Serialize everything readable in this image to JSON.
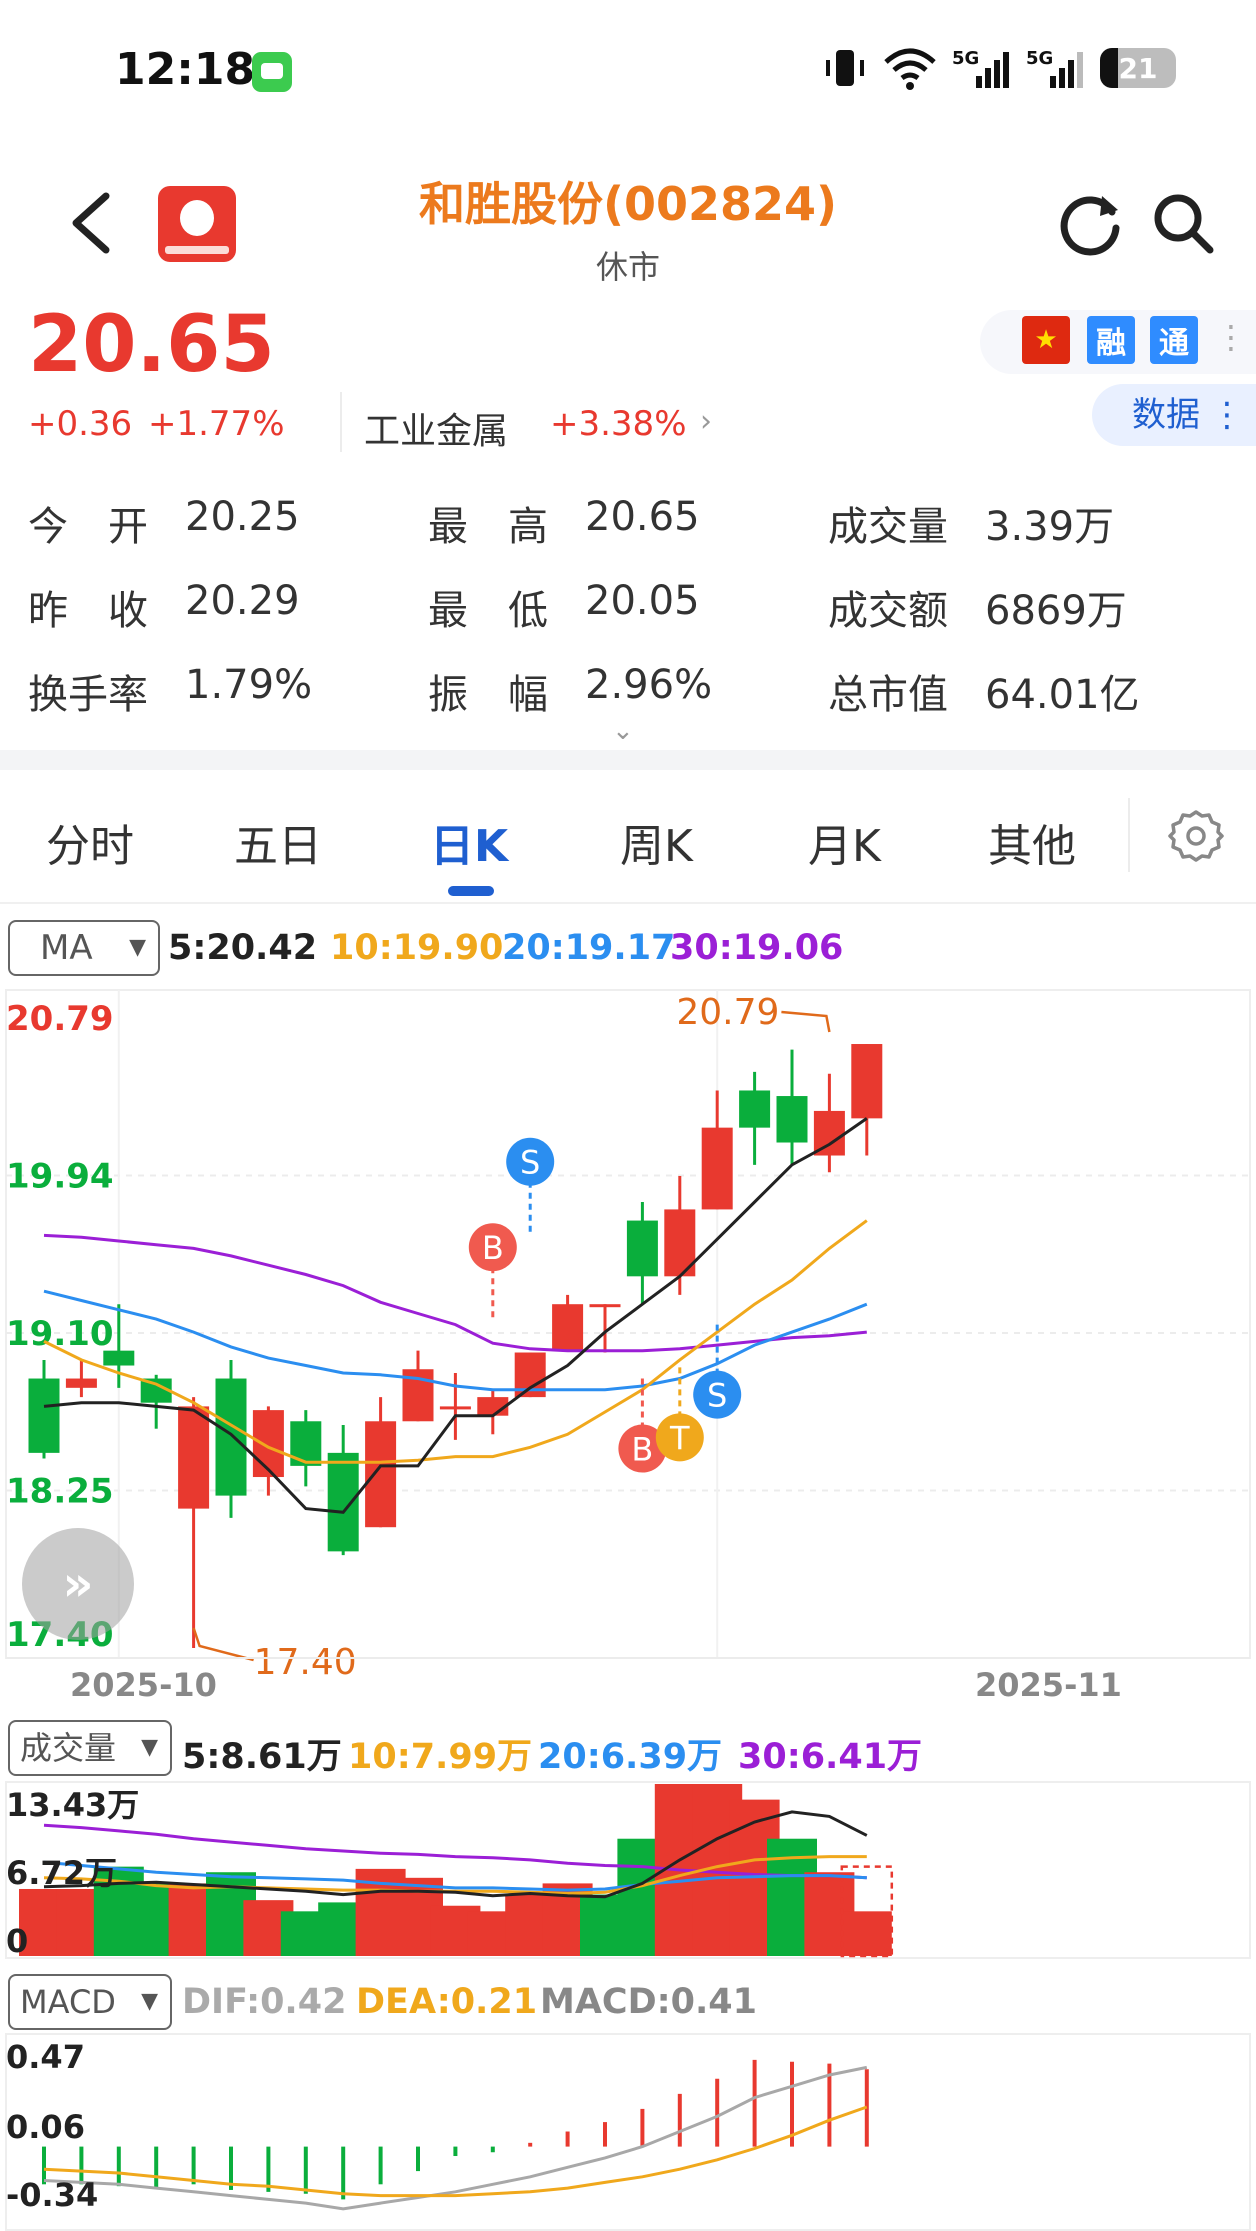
{
  "status_bar": {
    "time": "12:18",
    "signal_1": "5G",
    "signal_2": "5G",
    "battery": "21"
  },
  "header": {
    "title": "和胜股份(002824)",
    "status": "休市"
  },
  "quote": {
    "price": "20.65",
    "change": "+0.36",
    "change_pct": "+1.77%",
    "sector": "工业金属",
    "sector_pct": "+3.38%",
    "badges": [
      "融",
      "通"
    ],
    "data_button": "数据"
  },
  "stats": [
    [
      {
        "label": "今　开",
        "value": "20.25"
      },
      {
        "label": "最　高",
        "value": "20.65"
      },
      {
        "label": "成交量",
        "value": "3.39万"
      }
    ],
    [
      {
        "label": "昨　收",
        "value": "20.29"
      },
      {
        "label": "最　低",
        "value": "20.05"
      },
      {
        "label": "成交额",
        "value": "6869万"
      }
    ],
    [
      {
        "label": "换手率",
        "value": "1.79%"
      },
      {
        "label": "振　幅",
        "value": "2.96%"
      },
      {
        "label": "总市值",
        "value": "64.01亿"
      }
    ]
  ],
  "tabs": [
    "分时",
    "五日",
    "日K",
    "周K",
    "月K",
    "其他"
  ],
  "active_tab": "日K",
  "ma_row": {
    "selector": "MA",
    "ma5": "5:20.42",
    "ma10": "10:19.90",
    "ma20": "20:19.17",
    "ma30": "30:19.06"
  },
  "vol_row": {
    "selector": "成交量",
    "ma5": "5:8.61万",
    "ma10": "10:7.99万",
    "ma20": "20:6.39万",
    "ma30": "30:6.41万"
  },
  "macd_row": {
    "selector": "MACD",
    "dif": "DIF:0.42",
    "dea": "DEA:0.21",
    "macd": "MACD:0.41"
  },
  "colors": {
    "up": "#e8392f",
    "down": "#0aae3c",
    "ma5": "#222222",
    "ma10": "#f0a81c",
    "ma20": "#2b8ef0",
    "ma30": "#9b1fd6",
    "accent": "#1f5fd0"
  },
  "chart_data": [
    {
      "type": "candlestick",
      "y_ticks": [
        "20.79",
        "19.94",
        "19.10",
        "18.25",
        "17.40"
      ],
      "ylim": [
        17.4,
        20.79
      ],
      "x_ticks": [
        "2025-10",
        "2025-11"
      ],
      "max_label": "20.79",
      "min_label": "17.40",
      "candles": [
        {
          "o": 18.85,
          "h": 18.95,
          "l": 18.42,
          "c": 18.45
        },
        {
          "o": 18.8,
          "h": 18.95,
          "l": 18.75,
          "c": 18.85
        },
        {
          "o": 19.0,
          "h": 19.25,
          "l": 18.8,
          "c": 18.92
        },
        {
          "o": 18.85,
          "h": 18.87,
          "l": 18.58,
          "c": 18.72
        },
        {
          "o": 18.15,
          "h": 18.75,
          "l": 17.4,
          "c": 18.7
        },
        {
          "o": 18.85,
          "h": 18.95,
          "l": 18.1,
          "c": 18.22
        },
        {
          "o": 18.32,
          "h": 18.7,
          "l": 18.22,
          "c": 18.68
        },
        {
          "o": 18.62,
          "h": 18.68,
          "l": 18.27,
          "c": 18.38
        },
        {
          "o": 18.45,
          "h": 18.6,
          "l": 17.9,
          "c": 17.92
        },
        {
          "o": 18.05,
          "h": 18.75,
          "l": 18.05,
          "c": 18.62
        },
        {
          "o": 18.62,
          "h": 19.0,
          "l": 18.62,
          "c": 18.9
        },
        {
          "o": 18.7,
          "h": 18.88,
          "l": 18.52,
          "c": 18.7
        },
        {
          "o": 18.65,
          "h": 18.79,
          "l": 18.55,
          "c": 18.75
        },
        {
          "o": 18.75,
          "h": 18.99,
          "l": 18.75,
          "c": 18.99
        },
        {
          "o": 19.0,
          "h": 19.3,
          "l": 19.0,
          "c": 19.25
        },
        {
          "o": 19.25,
          "h": 19.25,
          "l": 18.99,
          "c": 19.25
        },
        {
          "o": 19.7,
          "h": 19.8,
          "l": 19.25,
          "c": 19.4
        },
        {
          "o": 19.4,
          "h": 19.94,
          "l": 19.3,
          "c": 19.76
        },
        {
          "o": 19.76,
          "h": 20.4,
          "l": 19.76,
          "c": 20.2
        },
        {
          "o": 20.4,
          "h": 20.5,
          "l": 20.0,
          "c": 20.2
        },
        {
          "o": 20.37,
          "h": 20.62,
          "l": 20.0,
          "c": 20.12
        },
        {
          "o": 20.05,
          "h": 20.49,
          "l": 19.96,
          "c": 20.29
        },
        {
          "o": 20.25,
          "h": 20.65,
          "l": 20.05,
          "c": 20.65
        }
      ],
      "ma5": [
        18.7,
        18.72,
        18.72,
        18.7,
        18.68,
        18.55,
        18.36,
        18.15,
        18.13,
        18.38,
        18.38,
        18.65,
        18.65,
        18.8,
        18.92,
        19.1,
        19.25,
        19.4,
        19.6,
        19.8,
        20.0,
        20.11,
        20.25
      ],
      "ma10": [
        19.05,
        18.95,
        18.88,
        18.82,
        18.72,
        18.6,
        18.48,
        18.4,
        18.4,
        18.4,
        18.41,
        18.43,
        18.43,
        18.48,
        18.55,
        18.67,
        18.79,
        18.95,
        19.1,
        19.25,
        19.38,
        19.55,
        19.7
      ],
      "ma20": [
        19.32,
        19.27,
        19.22,
        19.17,
        19.1,
        19.02,
        18.96,
        18.92,
        18.88,
        18.87,
        18.85,
        18.81,
        18.79,
        18.79,
        18.79,
        18.79,
        18.81,
        18.85,
        18.93,
        19.03,
        19.1,
        19.17,
        19.25
      ],
      "ma30": [
        19.62,
        19.61,
        19.59,
        19.57,
        19.55,
        19.51,
        19.46,
        19.41,
        19.35,
        19.26,
        19.2,
        19.14,
        19.04,
        19.01,
        19.0,
        19.0,
        19.0,
        19.01,
        19.03,
        19.05,
        19.07,
        19.08,
        19.1
      ],
      "markers": [
        {
          "label": "B",
          "index": 12,
          "price": 19.18,
          "color": "#f05a4f",
          "placement": "above"
        },
        {
          "label": "S",
          "index": 13,
          "price": 19.64,
          "color": "#2b8ef0",
          "placement": "above"
        },
        {
          "label": "B",
          "index": 16,
          "price": 18.85,
          "color": "#f05a4f",
          "placement": "below"
        },
        {
          "label": "T",
          "index": 17,
          "price": 18.91,
          "color": "#f0a81c",
          "placement": "below"
        },
        {
          "label": "S",
          "index": 18,
          "price": 19.14,
          "color": "#2b8ef0",
          "placement": "below"
        }
      ]
    },
    {
      "type": "bar",
      "title": "成交量",
      "y_ticks": [
        "13.43万",
        "6.72万",
        "0"
      ],
      "ylim": [
        0,
        13.43
      ],
      "values": [
        6.0,
        6.0,
        8.0,
        6.5,
        6.5,
        7.5,
        5.0,
        4.0,
        4.8,
        7.8,
        7.0,
        4.5,
        4.0,
        5.5,
        6.5,
        5.5,
        10.5,
        16.0,
        15.5,
        14.0,
        10.5,
        7.5,
        4.0
      ],
      "colors": [
        "up",
        "up",
        "down",
        "down",
        "up",
        "down",
        "up",
        "down",
        "down",
        "up",
        "up",
        "up",
        "up",
        "up",
        "up",
        "down",
        "down",
        "up",
        "up",
        "up",
        "down",
        "up",
        "up"
      ],
      "last_dashed_value": 8.0,
      "ma5": [
        6.2,
        6.3,
        6.5,
        6.6,
        6.4,
        6.2,
        6.0,
        5.8,
        5.5,
        5.8,
        5.8,
        5.7,
        5.4,
        5.6,
        5.4,
        5.3,
        6.5,
        8.6,
        10.5,
        12.0,
        12.9,
        12.5,
        10.8
      ],
      "ma10": [
        7.0,
        6.9,
        6.7,
        6.3,
        6.1,
        6.2,
        6.1,
        6.0,
        5.9,
        5.9,
        5.8,
        5.8,
        5.8,
        5.7,
        5.6,
        5.7,
        6.3,
        7.2,
        8.0,
        8.6,
        8.8,
        8.9,
        8.9
      ],
      "ma20": [
        8.4,
        8.1,
        7.8,
        7.5,
        7.3,
        7.1,
        7.0,
        6.9,
        6.8,
        6.5,
        6.3,
        6.1,
        6.1,
        6.0,
        5.9,
        6.0,
        6.4,
        6.7,
        7.0,
        7.1,
        7.2,
        7.2,
        7.0
      ],
      "ma30": [
        11.7,
        11.5,
        11.2,
        10.9,
        10.5,
        10.2,
        9.9,
        9.6,
        9.4,
        9.2,
        9.1,
        8.9,
        8.8,
        8.6,
        8.3,
        8.1,
        8.0,
        7.7,
        7.5,
        7.3,
        7.2,
        7.2,
        7.0
      ]
    },
    {
      "type": "macd",
      "y_ticks": [
        "0.47",
        "0.06",
        "-0.34"
      ],
      "ylim": [
        -0.4,
        0.47
      ],
      "hist": [
        -0.2,
        -0.2,
        -0.21,
        -0.22,
        -0.2,
        -0.23,
        -0.24,
        -0.25,
        -0.28,
        -0.2,
        -0.13,
        -0.05,
        -0.03,
        0.02,
        0.08,
        0.13,
        0.2,
        0.28,
        0.36,
        0.46,
        0.45,
        0.44,
        0.41
      ],
      "dif": [
        -0.18,
        -0.19,
        -0.2,
        -0.22,
        -0.24,
        -0.26,
        -0.28,
        -0.3,
        -0.33,
        -0.3,
        -0.27,
        -0.24,
        -0.2,
        -0.16,
        -0.11,
        -0.06,
        0.0,
        0.08,
        0.16,
        0.26,
        0.32,
        0.38,
        0.42
      ],
      "dea": [
        -0.12,
        -0.13,
        -0.14,
        -0.16,
        -0.18,
        -0.2,
        -0.21,
        -0.23,
        -0.25,
        -0.26,
        -0.26,
        -0.26,
        -0.25,
        -0.24,
        -0.22,
        -0.19,
        -0.16,
        -0.12,
        -0.07,
        -0.01,
        0.06,
        0.14,
        0.21
      ]
    }
  ]
}
